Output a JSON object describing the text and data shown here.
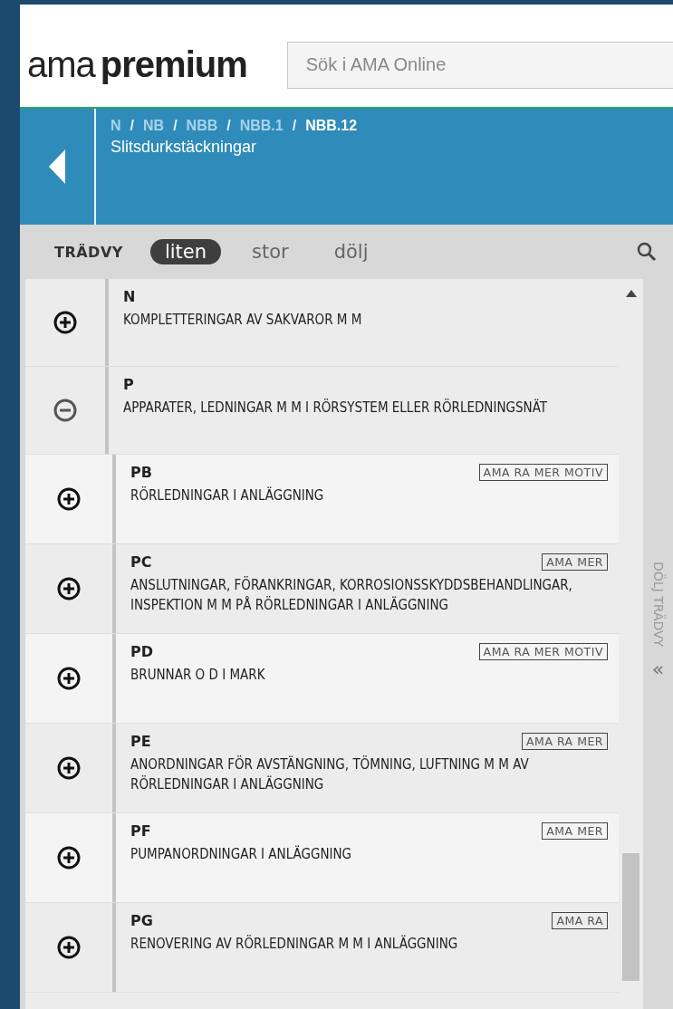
{
  "header": {
    "logo_light": "ama",
    "logo_bold": "premium",
    "search": {
      "placeholder": "Sök i AMA Online"
    }
  },
  "location": {
    "breadcrumb_separator": "/",
    "breadcrumb": [
      {
        "label": "N",
        "selected": false
      },
      {
        "label": "NB",
        "selected": false
      },
      {
        "label": "NBB",
        "selected": false
      },
      {
        "label": "NBB.1",
        "selected": false
      },
      {
        "label": "NBB.12",
        "selected": true
      }
    ],
    "title": "Slitsdurkstäckningar"
  },
  "toolbar": {
    "label": "TRÄDVY",
    "sizes": [
      {
        "label": "liten",
        "selected": true
      },
      {
        "label": "stor",
        "selected": false
      },
      {
        "label": "dölj",
        "selected": false
      }
    ]
  },
  "tree": [
    {
      "code": "N",
      "title": "KOMPLETTERINGAR AV SAKVAROR M M",
      "expanded": false
    },
    {
      "code": "P",
      "title": "APPARATER, LEDNINGAR M M I RÖRSYSTEM ELLER RÖRLEDNINGSNÄT",
      "expanded": true,
      "children": [
        {
          "code": "PB",
          "title": "RÖRLEDNINGAR I ANLÄGGNING",
          "tags": "AMA RA MER MOTIV",
          "expanded": false
        },
        {
          "code": "PC",
          "title": "ANSLUTNINGAR, FÖRANKRINGAR, KORROSIONSSKYDDSBEHANDLINGAR, INSPEKTION M M PÅ RÖRLEDNINGAR I ANLÄGGNING",
          "tags": "AMA MER",
          "expanded": false
        },
        {
          "code": "PD",
          "title": "BRUNNAR O D I MARK",
          "tags": "AMA RA MER MOTIV",
          "expanded": false
        },
        {
          "code": "PE",
          "title": "ANORDNINGAR FÖR AVSTÄNGNING, TÖMNING, LUFTNING M M AV RÖRLEDNINGAR I ANLÄGGNING",
          "tags": "AMA RA MER",
          "expanded": false
        },
        {
          "code": "PF",
          "title": "PUMPANORDNINGAR I ANLÄGGNING",
          "tags": "AMA MER",
          "expanded": false
        },
        {
          "code": "PG",
          "title": "RENOVERING AV RÖRLEDNINGAR M M I ANLÄGGNING",
          "tags": "AMA RA",
          "expanded": false
        }
      ]
    }
  ],
  "side_panel": {
    "label": "DÖLJ TRÄDVY",
    "icon_text": "«"
  }
}
